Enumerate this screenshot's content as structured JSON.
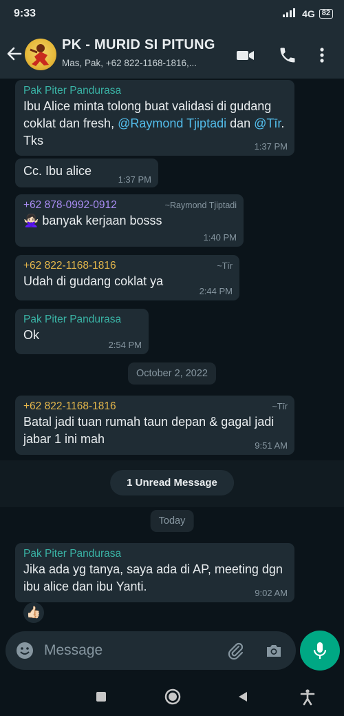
{
  "status_bar": {
    "time": "9:33",
    "network": "4G",
    "battery": "82"
  },
  "header": {
    "title": "PK - MURID SI PITUNG",
    "subtitle": "Mas, Pak, +62 822-1168-1816,..."
  },
  "messages": [
    {
      "sender": "Pak Piter Pandurasa",
      "sender_color": "#3ab4a6",
      "text_parts": [
        "Ibu Alice minta tolong buat validasi di gudang coklat dan fresh, ",
        "@Raymond Tjiptadi",
        " dan ",
        "@Tīr",
        ". Tks"
      ],
      "time": "1:37 PM"
    },
    {
      "text": "Cc. Ibu alice",
      "time": "1:37 PM"
    },
    {
      "sender": "+62 878-0992-0912",
      "sender_color": "#a98cf3",
      "sender_tag": "~Raymond Tjiptadi",
      "text": "🙅🏻‍♀️ banyak kerjaan bosss",
      "time": "1:40 PM"
    },
    {
      "sender": "+62 822-1168-1816",
      "sender_color": "#e5b74b",
      "sender_tag": "~Tīr",
      "text": "Udah di gudang coklat ya",
      "time": "2:44 PM"
    },
    {
      "sender": "Pak Piter Pandurasa",
      "sender_color": "#3ab4a6",
      "text": "Ok",
      "time": "2:54 PM"
    },
    {
      "sender": "+62 822-1168-1816",
      "sender_color": "#e5b74b",
      "sender_tag": "~Tīr",
      "text": "Batal jadi tuan rumah taun depan & gagal jadi jabar 1 ini mah",
      "time": "9:51 AM"
    },
    {
      "sender": "Pak Piter Pandurasa",
      "sender_color": "#3ab4a6",
      "text": "Jika ada yg tanya, saya ada di AP, meeting dgn ibu alice dan ibu Yanti.",
      "time": "9:02 AM",
      "reaction": "👍🏻"
    }
  ],
  "date_divider_1": "October 2, 2022",
  "unread_label": "1 Unread Message",
  "date_divider_2": "Today",
  "composer": {
    "placeholder": "Message"
  },
  "colors": {
    "accent": "#00a884",
    "bubble": "#1f2c34",
    "background": "#0b141a"
  },
  "icons": [
    "back-arrow-icon",
    "video-call-icon",
    "phone-icon",
    "more-options-icon",
    "emoji-icon",
    "attach-icon",
    "camera-icon",
    "mic-icon",
    "nav-square-icon",
    "nav-circle-icon",
    "nav-back-icon",
    "accessibility-icon"
  ]
}
